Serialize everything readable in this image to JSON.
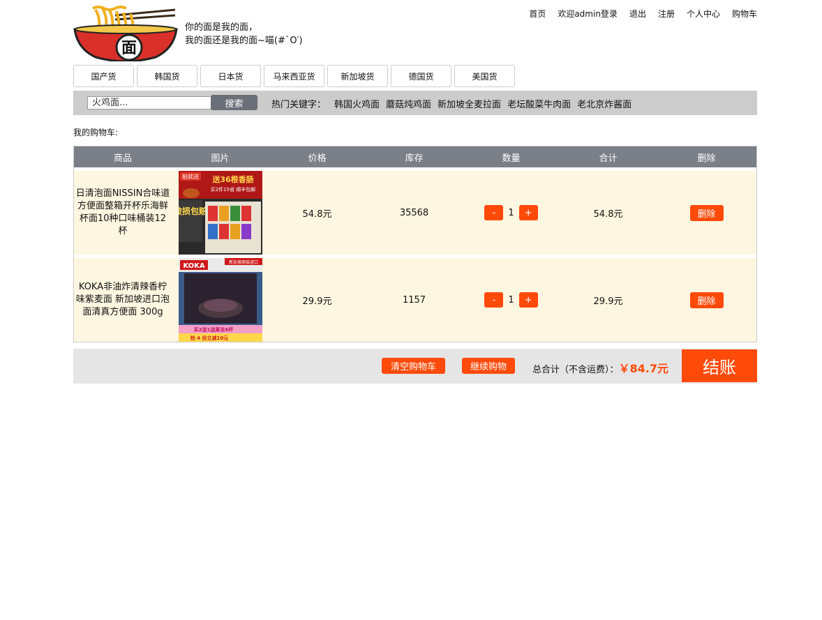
{
  "header": {
    "slogan_line1": "你的面是我的面，",
    "slogan_line2": "我的面还是我的面~喵(#`O′)",
    "logo_char": "面"
  },
  "topnav": [
    "首页",
    "欢迎admin登录",
    "退出",
    "注册",
    "个人中心",
    "购物车"
  ],
  "categories": [
    "国产货",
    "韩国货",
    "日本货",
    "马来西亚货",
    "新加坡货",
    "德国货",
    "美国货"
  ],
  "search": {
    "value": "火鸡面...",
    "button": "搜索",
    "hot_label": "热门关键字：",
    "hot_keywords": [
      "韩国火鸡面",
      "蘑菇炖鸡面",
      "新加坡全麦拉面",
      "老坛酸菜牛肉面",
      "老北京炸酱面"
    ]
  },
  "cart": {
    "label": "我的购物车:",
    "columns": [
      "商品",
      "图片",
      "价格",
      "库存",
      "数量",
      "合计",
      "删除"
    ],
    "items": [
      {
        "name": "日清泡面NISSIN合味道方便面整箱开杯乐海鲜杯面10种口味桶装12杯",
        "price": "54.8元",
        "stock": "35568",
        "qty": "1",
        "subtotal": "54.8元",
        "delete": "删除",
        "img_text1": "送36根香肠",
        "img_text2": "破损包赔",
        "img_tag": "拍就送",
        "img_sub": "买2件15省 顺丰包邮"
      },
      {
        "name": "KOKA非油炸清辣香柠味紫麦面 新加坡进口泡面清真方便面 300g",
        "price": "29.9元",
        "stock": "1157",
        "qty": "1",
        "subtotal": "29.9元",
        "delete": "删除",
        "img_brand": "KOKA",
        "img_tag": "新加坡原装进口",
        "img_text1": "买2送1送果冻6杯",
        "img_text2": "拍 4 份立减10元"
      }
    ],
    "minus": "-",
    "plus": "+"
  },
  "footer": {
    "clear": "清空购物车",
    "continue": "继续购物",
    "total_label": "总合计（不含运费）：",
    "total_value": "￥84.7元",
    "checkout": "结账"
  },
  "colors": {
    "accent": "#ff4a0a",
    "header_gray": "#7b7f87",
    "row_bg": "#fdf6e0"
  }
}
